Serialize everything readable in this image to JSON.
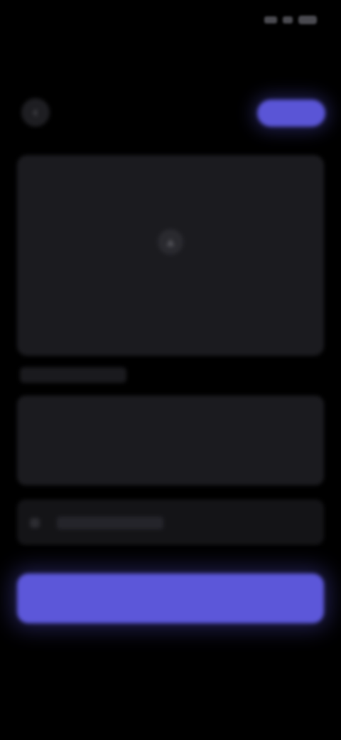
{
  "status_bar": {
    "time": "",
    "icons": [
      "signal-icon",
      "wifi-icon",
      "battery-icon"
    ]
  },
  "nav": {
    "back_icon": "‹",
    "action_label": ""
  },
  "upload": {
    "icon": "▲",
    "label": ""
  },
  "section": {
    "label": ""
  },
  "text_area": {
    "placeholder": ""
  },
  "toggle": {
    "label": ""
  },
  "primary": {
    "label": ""
  },
  "colors": {
    "background": "#000000",
    "card": "#1b1b1f",
    "accent": "#5c57d9"
  }
}
